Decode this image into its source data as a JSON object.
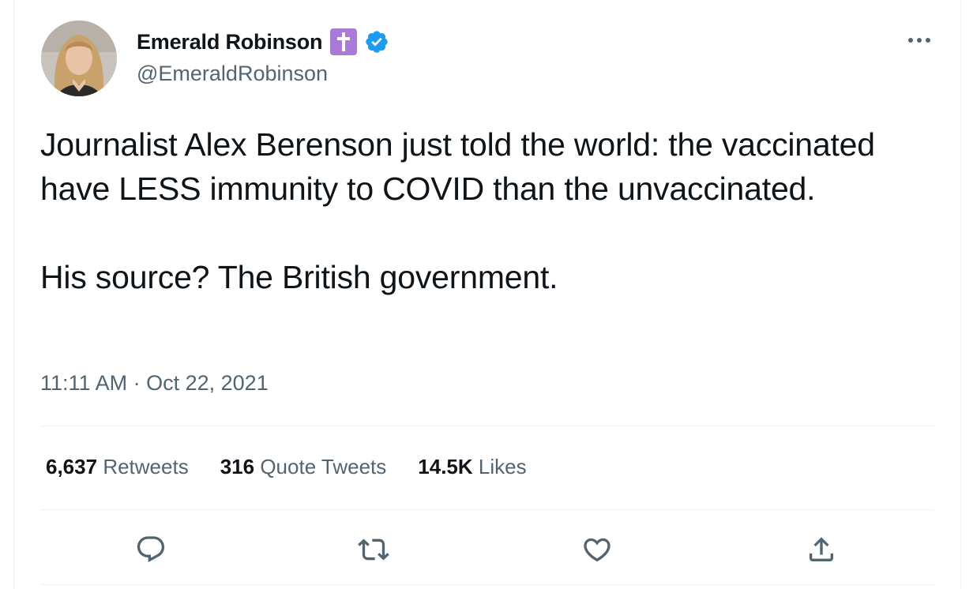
{
  "author": {
    "display_name": "Emerald Robinson",
    "handle": "@EmeraldRobinson",
    "badge_icon": "latin-cross-badge-icon",
    "verified_icon": "verified-badge-icon",
    "verified_color": "#1d9bf0"
  },
  "tweet": {
    "text": "Journalist Alex Berenson just told the world: the vaccinated have LESS immunity to COVID than the unvaccinated.\n\nHis source? The British government.",
    "time": "11:11 AM",
    "separator": "·",
    "date": "Oct 22, 2021"
  },
  "stats": {
    "retweets_count": "6,637",
    "retweets_label": "Retweets",
    "quotes_count": "316",
    "quotes_label": "Quote Tweets",
    "likes_count": "14.5K",
    "likes_label": "Likes"
  },
  "actions": {
    "reply_icon": "reply-icon",
    "retweet_icon": "retweet-icon",
    "like_icon": "heart-icon",
    "share_icon": "share-icon"
  },
  "colors": {
    "text_primary": "#0f1419",
    "text_secondary": "#536471",
    "divider": "#eff3f4",
    "badge_purple": "#a97bd6"
  }
}
